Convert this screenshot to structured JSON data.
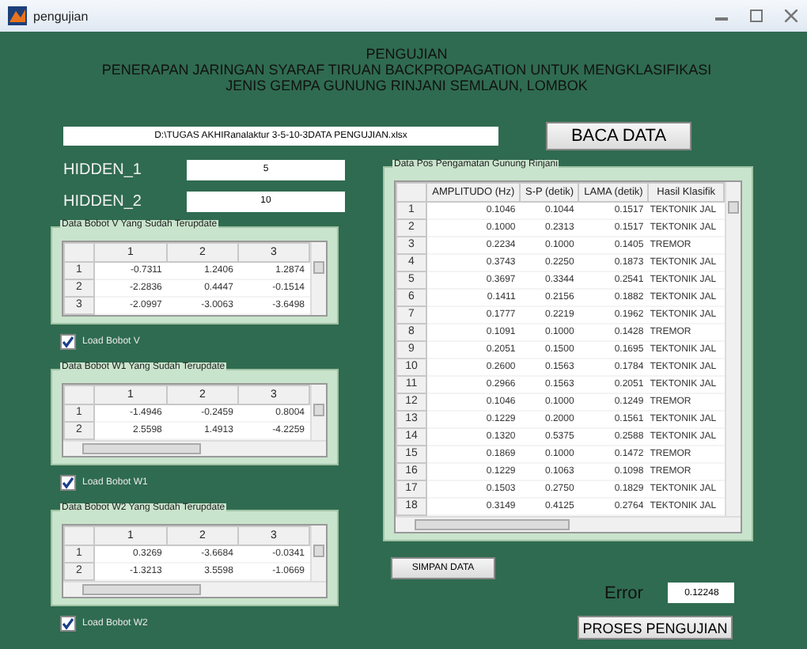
{
  "window": {
    "title": "pengujian"
  },
  "heading": [
    "PENGUJIAN",
    "PENERAPAN JARINGAN SYARAF TIRUAN BACKPROPAGATION UNTUK MENGKLASIFIKASI",
    "JENIS GEMPA GUNUNG RINJANI SEMLAUN, LOMBOK"
  ],
  "file_path": "D:\\TUGAS AKHIRanalaktur 3-5-10-3DATA PENGUJIAN.xlsx",
  "read_button": "BACA DATA",
  "hidden": [
    {
      "label": "HIDDEN_1",
      "value": "5"
    },
    {
      "label": "HIDDEN_2",
      "value": "10"
    }
  ],
  "weight_panels": [
    {
      "title": "Data Bobot  V Yang Sudah Terupdate",
      "columns": [
        "",
        "1",
        "2",
        "3"
      ],
      "horizontal_scrollbar": false,
      "rows": [
        [
          "1",
          "-0.7311",
          "1.2406",
          "1.2874"
        ],
        [
          "2",
          "-2.2836",
          "0.4447",
          "-0.1514"
        ],
        [
          "3",
          "-2.0997",
          "-3.0063",
          "-3.6498"
        ]
      ],
      "checkbox": {
        "label": "Load Bobot V",
        "checked": true
      }
    },
    {
      "title": "Data Bobot  W1 Yang Sudah Terupdate",
      "columns": [
        "",
        "1",
        "2",
        "3"
      ],
      "horizontal_scrollbar": true,
      "rows": [
        [
          "1",
          "-1.4946",
          "-0.2459",
          "0.8004"
        ],
        [
          "2",
          "2.5598",
          "1.4913",
          "-4.2259"
        ]
      ],
      "checkbox": {
        "label": "Load Bobot W1",
        "checked": true
      }
    },
    {
      "title": "Data Bobot  W2 Yang Sudah Terupdate",
      "columns": [
        "",
        "1",
        "2",
        "3"
      ],
      "horizontal_scrollbar": true,
      "rows": [
        [
          "1",
          "0.3269",
          "-3.6684",
          "-0.0341"
        ],
        [
          "2",
          "-1.3213",
          "3.5598",
          "-1.0669"
        ]
      ],
      "checkbox": {
        "label": "Load Bobot W2",
        "checked": true
      }
    }
  ],
  "data_panel": {
    "title": "Data Pos Pengamatan Gunung Rinjani",
    "columns": [
      "",
      "AMPLITUDO (Hz)",
      "S-P (detik)",
      "LAMA (detik)",
      "Hasil Klasifik"
    ],
    "rows": [
      [
        "1",
        "0.1046",
        "0.1044",
        "0.1517",
        "TEKTONIK JAL"
      ],
      [
        "2",
        "0.1000",
        "0.2313",
        "0.1517",
        "TEKTONIK JAL"
      ],
      [
        "3",
        "0.2234",
        "0.1000",
        "0.1405",
        "TREMOR"
      ],
      [
        "4",
        "0.3743",
        "0.2250",
        "0.1873",
        "TEKTONIK JAL"
      ],
      [
        "5",
        "0.3697",
        "0.3344",
        "0.2541",
        "TEKTONIK JAL"
      ],
      [
        "6",
        "0.1411",
        "0.2156",
        "0.1882",
        "TEKTONIK JAL"
      ],
      [
        "7",
        "0.1777",
        "0.2219",
        "0.1962",
        "TEKTONIK JAL"
      ],
      [
        "8",
        "0.1091",
        "0.1000",
        "0.1428",
        "TREMOR"
      ],
      [
        "9",
        "0.2051",
        "0.1500",
        "0.1695",
        "TEKTONIK JAL"
      ],
      [
        "10",
        "0.2600",
        "0.1563",
        "0.1784",
        "TEKTONIK JAL"
      ],
      [
        "11",
        "0.2966",
        "0.1563",
        "0.2051",
        "TEKTONIK JAL"
      ],
      [
        "12",
        "0.1046",
        "0.1000",
        "0.1249",
        "TREMOR"
      ],
      [
        "13",
        "0.1229",
        "0.2000",
        "0.1561",
        "TEKTONIK JAL"
      ],
      [
        "14",
        "0.1320",
        "0.5375",
        "0.2588",
        "TEKTONIK JAL"
      ],
      [
        "15",
        "0.1869",
        "0.1000",
        "0.1472",
        "TREMOR"
      ],
      [
        "16",
        "0.1229",
        "0.1063",
        "0.1098",
        "TREMOR"
      ],
      [
        "17",
        "0.1503",
        "0.2750",
        "0.1829",
        "TEKTONIK JAL"
      ],
      [
        "18",
        "0.3149",
        "0.4125",
        "0.2764",
        "TEKTONIK JAL"
      ]
    ]
  },
  "save_button": "SIMPAN DATA",
  "error": {
    "label": "Error",
    "value": "0.12248"
  },
  "process_button": "PROSES PENGUJIAN"
}
